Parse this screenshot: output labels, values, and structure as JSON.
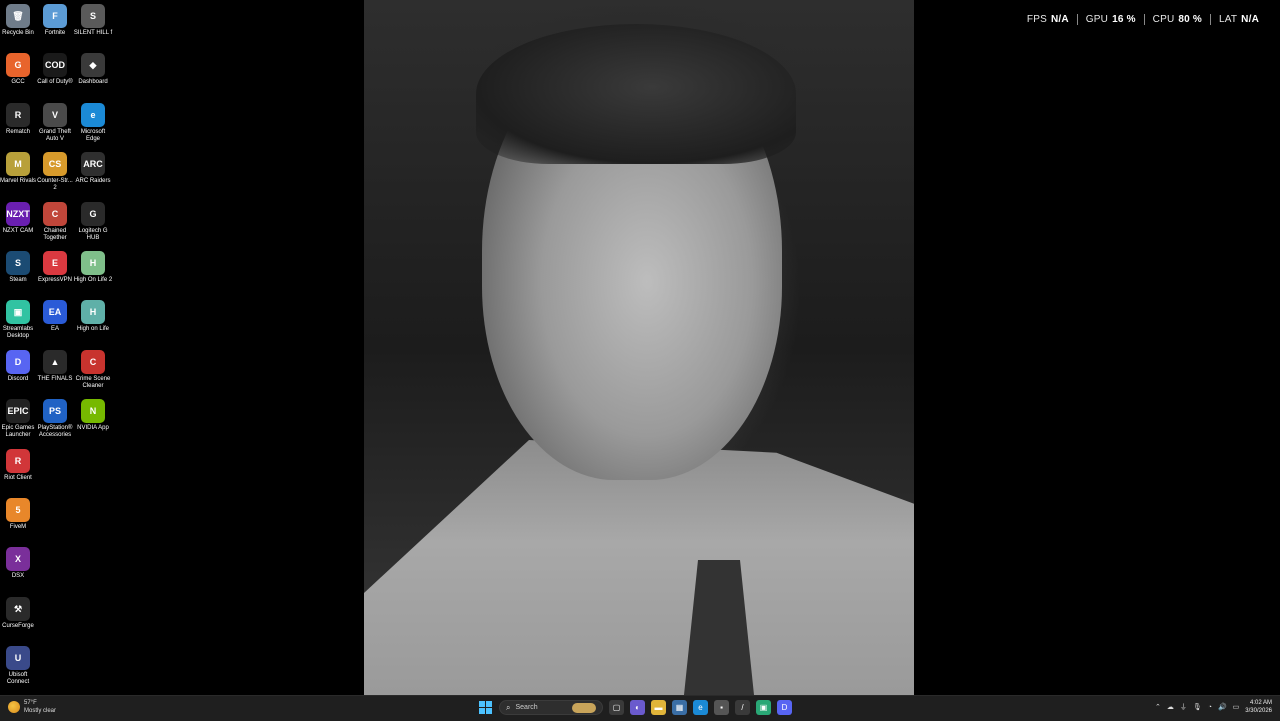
{
  "desktop": {
    "icons": [
      {
        "label": "Recycle Bin",
        "icon": "recycle-bin-icon",
        "glyph": "🗑",
        "color": "#6f7c8a"
      },
      {
        "label": "Fortnite",
        "icon": "fortnite-icon",
        "glyph": "F",
        "color": "#5b9bd5"
      },
      {
        "label": "SILENT HILL f",
        "icon": "silent-hill-icon",
        "glyph": "S",
        "color": "#5a5a5a"
      },
      {
        "label": "GCC",
        "icon": "gcc-icon",
        "glyph": "G",
        "color": "#e8642c"
      },
      {
        "label": "Call of Duty®",
        "icon": "call-of-duty-icon",
        "glyph": "COD",
        "color": "#1a1a1a"
      },
      {
        "label": "Dashboard",
        "icon": "dashboard-icon",
        "glyph": "◆",
        "color": "#3a3a3a"
      },
      {
        "label": "Rematch",
        "icon": "rematch-icon",
        "glyph": "R",
        "color": "#2a2a2a"
      },
      {
        "label": "Grand Theft Auto V",
        "icon": "gta-v-icon",
        "glyph": "V",
        "color": "#4a4a4a"
      },
      {
        "label": "Microsoft Edge",
        "icon": "edge-icon",
        "glyph": "e",
        "color": "#1b8ad6"
      },
      {
        "label": "Marvel Rivals",
        "icon": "marvel-rivals-icon",
        "glyph": "M",
        "color": "#b8a03a"
      },
      {
        "label": "Counter-Str... 2",
        "icon": "counter-strike-icon",
        "glyph": "CS",
        "color": "#d79a2b"
      },
      {
        "label": "ARC Raiders",
        "icon": "arc-raiders-icon",
        "glyph": "ARC",
        "color": "#2f2f2f"
      },
      {
        "label": "NZXT CAM",
        "icon": "nzxt-cam-icon",
        "glyph": "NZXT",
        "color": "#6a1fb0"
      },
      {
        "label": "Chained Together",
        "icon": "chained-together-icon",
        "glyph": "C",
        "color": "#c0463a"
      },
      {
        "label": "Logitech G HUB",
        "icon": "logitech-icon",
        "glyph": "G",
        "color": "#2a2a2a"
      },
      {
        "label": "Steam",
        "icon": "steam-icon",
        "glyph": "S",
        "color": "#1b4b73"
      },
      {
        "label": "ExpressVPN",
        "icon": "expressvpn-icon",
        "glyph": "E",
        "color": "#da3940"
      },
      {
        "label": "High On Life 2",
        "icon": "high-on-life-2-icon",
        "glyph": "H",
        "color": "#7fbf8a"
      },
      {
        "label": "Streamlabs Desktop",
        "icon": "streamlabs-icon",
        "glyph": "▣",
        "color": "#31c3a2"
      },
      {
        "label": "EA",
        "icon": "ea-icon",
        "glyph": "EA",
        "color": "#2a5bd7"
      },
      {
        "label": "High on Life",
        "icon": "high-on-life-icon",
        "glyph": "H",
        "color": "#5fb0a8"
      },
      {
        "label": "Discord",
        "icon": "discord-icon",
        "glyph": "D",
        "color": "#5865f2"
      },
      {
        "label": "THE FINALS",
        "icon": "the-finals-icon",
        "glyph": "▲",
        "color": "#2a2a2a"
      },
      {
        "label": "Crime Scene Cleaner",
        "icon": "crime-scene-cleaner-icon",
        "glyph": "C",
        "color": "#c8332e"
      },
      {
        "label": "Epic Games Launcher",
        "icon": "epic-games-icon",
        "glyph": "EPIC",
        "color": "#222"
      },
      {
        "label": "PlayStation® Accessories",
        "icon": "playstation-icon",
        "glyph": "PS",
        "color": "#2062c4"
      },
      {
        "label": "NVIDIA App",
        "icon": "nvidia-icon",
        "glyph": "N",
        "color": "#76b900"
      },
      {
        "label": "Riot Client",
        "icon": "riot-client-icon",
        "glyph": "R",
        "color": "#d13639"
      },
      {
        "label": "FiveM",
        "icon": "fivem-icon",
        "glyph": "5",
        "color": "#e8872a"
      },
      {
        "label": "DSX",
        "icon": "dsx-icon",
        "glyph": "X",
        "color": "#7a2f9a"
      },
      {
        "label": "CurseForge",
        "icon": "curseforge-icon",
        "glyph": "⚒",
        "color": "#2a2a2a"
      },
      {
        "label": "Ubisoft Connect",
        "icon": "ubisoft-icon",
        "glyph": "U",
        "color": "#3a4a8a"
      }
    ]
  },
  "overlay": {
    "stats": [
      {
        "label": "FPS",
        "value": "N/A"
      },
      {
        "label": "GPU",
        "value": "16 %"
      },
      {
        "label": "CPU",
        "value": "80 %"
      },
      {
        "label": "LAT",
        "value": "N/A"
      }
    ]
  },
  "taskbar": {
    "weather": {
      "temp": "57°F",
      "condition": "Mostly clear"
    },
    "search": {
      "placeholder": "Search"
    },
    "pinned": [
      {
        "icon": "task-view-icon",
        "glyph": "▢",
        "color": "#3a3a3a"
      },
      {
        "icon": "copilot-icon",
        "glyph": "◐",
        "color": "#6a5acd"
      },
      {
        "icon": "file-explorer-icon",
        "glyph": "▬",
        "color": "#e0b43a"
      },
      {
        "icon": "store-icon",
        "glyph": "▦",
        "color": "#3a6ea5"
      },
      {
        "icon": "edge-taskbar-icon",
        "glyph": "e",
        "color": "#1b8ad6"
      },
      {
        "icon": "app-taskbar-icon",
        "glyph": "▪",
        "color": "#555"
      },
      {
        "icon": "pen-app-icon",
        "glyph": "/",
        "color": "#3a3a3a"
      },
      {
        "icon": "nzxt-taskbar-icon",
        "glyph": "▣",
        "color": "#2aa876"
      },
      {
        "icon": "discord-taskbar-icon",
        "glyph": "D",
        "color": "#5865f2"
      }
    ],
    "tray": {
      "icons": [
        "chevron-up-icon",
        "cloud-icon",
        "usb-icon",
        "microphone-icon",
        "wifi-icon",
        "volume-icon",
        "battery-icon"
      ],
      "time": "4:02 AM",
      "date": "3/30/2026"
    }
  }
}
